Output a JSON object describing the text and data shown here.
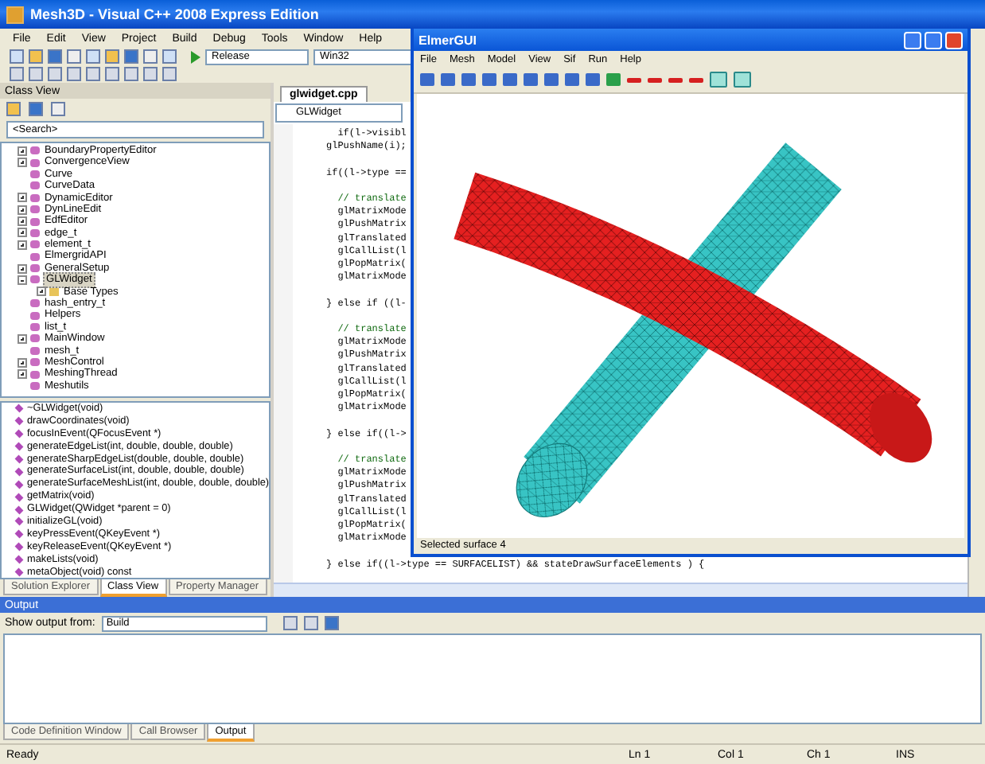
{
  "window": {
    "title": "Mesh3D - Visual C++ 2008 Express Edition"
  },
  "menu": [
    "File",
    "Edit",
    "View",
    "Project",
    "Build",
    "Debug",
    "Tools",
    "Window",
    "Help"
  ],
  "toolbar": {
    "configuration": "Release",
    "platform": "Win32"
  },
  "class_view": {
    "title": "Class View",
    "search": "<Search>",
    "tree": [
      {
        "label": "BoundaryPropertyEditor",
        "kind": "collapsed",
        "selected": false
      },
      {
        "label": "ConvergenceView",
        "kind": "collapsed",
        "selected": false
      },
      {
        "label": "Curve",
        "kind": "leaf",
        "selected": false
      },
      {
        "label": "CurveData",
        "kind": "leaf",
        "selected": false
      },
      {
        "label": "DynamicEditor",
        "kind": "collapsed",
        "selected": false
      },
      {
        "label": "DynLineEdit",
        "kind": "collapsed",
        "selected": false
      },
      {
        "label": "EdfEditor",
        "kind": "collapsed",
        "selected": false
      },
      {
        "label": "edge_t",
        "kind": "collapsed",
        "selected": false
      },
      {
        "label": "element_t",
        "kind": "collapsed",
        "selected": false
      },
      {
        "label": "ElmergridAPI",
        "kind": "leaf",
        "selected": false
      },
      {
        "label": "GeneralSetup",
        "kind": "collapsed",
        "selected": false
      },
      {
        "label": "GLWidget",
        "kind": "expanded",
        "selected": true,
        "children": [
          {
            "label": "Base Types",
            "kind": "collapsed",
            "selected": false
          }
        ]
      },
      {
        "label": "hash_entry_t",
        "kind": "leaf",
        "selected": false
      },
      {
        "label": "Helpers",
        "kind": "leaf",
        "selected": false
      },
      {
        "label": "list_t",
        "kind": "leaf",
        "selected": false
      },
      {
        "label": "MainWindow",
        "kind": "collapsed",
        "selected": false
      },
      {
        "label": "mesh_t",
        "kind": "leaf",
        "selected": false
      },
      {
        "label": "MeshControl",
        "kind": "collapsed",
        "selected": false
      },
      {
        "label": "MeshingThread",
        "kind": "collapsed",
        "selected": false
      },
      {
        "label": "Meshutils",
        "kind": "leaf",
        "selected": false
      }
    ],
    "members": [
      "~GLWidget(void)",
      "drawCoordinates(void)",
      "focusInEvent(QFocusEvent *)",
      "generateEdgeList(int, double, double, double)",
      "generateSharpEdgeList(double, double, double)",
      "generateSurfaceList(int, double, double, double)",
      "generateSurfaceMeshList(int, double, double, double)",
      "getMatrix(void)",
      "GLWidget(QWidget *parent = 0)",
      "initializeGL(void)",
      "keyPressEvent(QKeyEvent *)",
      "keyReleaseEvent(QKeyEvent *)",
      "makeLists(void)",
      "metaObject(void) const"
    ],
    "tabs": [
      {
        "label": "Solution Explorer",
        "selected": false
      },
      {
        "label": "Class View",
        "selected": true
      },
      {
        "label": "Property Manager",
        "selected": false
      }
    ]
  },
  "editor": {
    "tab": "glwidget.cpp",
    "scope": "GLWidget",
    "blocks": [
      [
        "  if(l->visibl",
        "glPushName(i);"
      ],
      [
        "if((l->type =="
      ],
      [
        "  // translate",
        "  glMatrixMode",
        "  glPushMatrix",
        "  glTranslated",
        "  glCallList(l",
        "  glPopMatrix(",
        "  glMatrixMode"
      ],
      [
        "} else if ((l-"
      ],
      [
        "  // translate",
        "  glMatrixMode",
        "  glPushMatrix",
        "  glTranslated",
        "  glCallList(l",
        "  glPopMatrix(",
        "  glMatrixMode"
      ],
      [
        "} else if((l->"
      ],
      [
        "  // translate",
        "  glMatrixMode",
        "  glPushMatrix",
        "  glTranslated",
        "  glCallList(l",
        "  glPopMatrix(",
        "  glMatrixMode"
      ],
      [
        "} else if((l->type == SURFACELIST) && stateDrawSurfaceElements ) {"
      ]
    ]
  },
  "elmer": {
    "title": "ElmerGUI",
    "menu": [
      "File",
      "Mesh",
      "Model",
      "View",
      "Sif",
      "Run",
      "Help"
    ],
    "status": "Selected surface 4"
  },
  "output": {
    "title": "Output",
    "label": "Show output from:",
    "source": "Build",
    "tabs": [
      {
        "label": "Code Definition Window",
        "selected": false
      },
      {
        "label": "Call Browser",
        "selected": false
      },
      {
        "label": "Output",
        "selected": true
      }
    ]
  },
  "status_bar": {
    "message": "Ready",
    "line": "Ln 1",
    "column": "Col 1",
    "char": "Ch 1",
    "mode": "INS"
  }
}
